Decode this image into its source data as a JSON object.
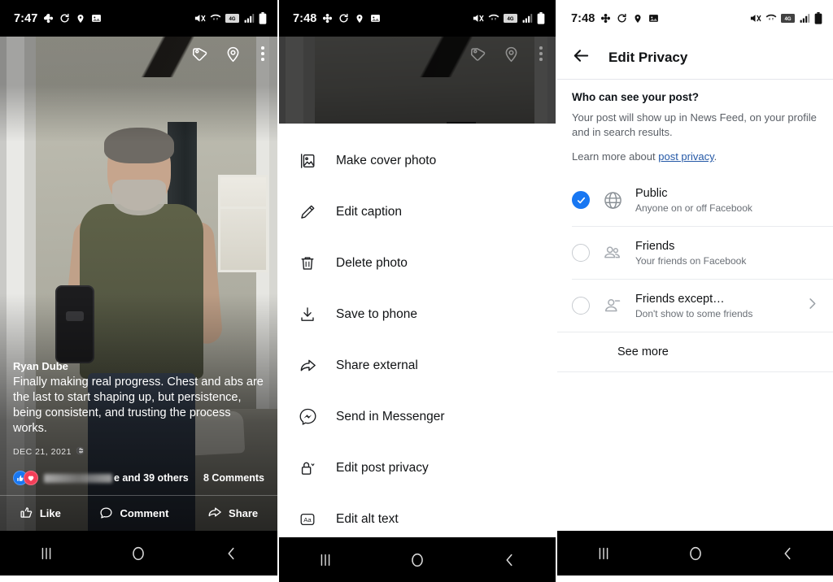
{
  "panels": {
    "photo_viewer": {
      "statusbar": {
        "time": "7:47",
        "left_icons": [
          "clover-icon",
          "sync-icon",
          "location-icon",
          "photo-icon"
        ],
        "right_icons": [
          "mute-icon",
          "wifi-transfer-icon",
          "lte-icon",
          "signal-icon",
          "battery-icon"
        ]
      },
      "topbar": {
        "tag_icon": "tag-icon",
        "location_icon": "location-pin-icon",
        "overflow_icon": "kebab-menu-icon"
      },
      "post": {
        "author": "Ryan Dube",
        "text": "Finally making real progress. Chest and abs are the last to start shaping up, but persistence, being consistent, and trusting the process works.",
        "date": "DEC 21, 2021",
        "audience_icon": "globe-icon",
        "reactions_icons": [
          "like-reaction-icon",
          "love-reaction-icon"
        ],
        "reactions_text": "e and 39 others",
        "comments_text": "8 Comments"
      },
      "actions": [
        {
          "label": "Like",
          "icon": "thumbs-up-icon"
        },
        {
          "label": "Comment",
          "icon": "comment-bubble-icon"
        },
        {
          "label": "Share",
          "icon": "share-arrow-icon"
        }
      ]
    },
    "photo_menu": {
      "statusbar": {
        "time": "7:48",
        "left_icons": [
          "clover-icon",
          "sync-icon",
          "location-icon",
          "photo-icon"
        ],
        "right_icons": [
          "mute-icon",
          "wifi-transfer-icon",
          "lte-icon",
          "signal-icon",
          "battery-icon"
        ]
      },
      "items": [
        {
          "label": "Make cover photo",
          "icon": "image-frame-icon"
        },
        {
          "label": "Edit caption",
          "icon": "pencil-icon"
        },
        {
          "label": "Delete photo",
          "icon": "trash-icon"
        },
        {
          "label": "Save to phone",
          "icon": "download-icon"
        },
        {
          "label": "Share external",
          "icon": "share-arrow-icon"
        },
        {
          "label": "Send in Messenger",
          "icon": "messenger-icon"
        },
        {
          "label": "Edit post privacy",
          "icon": "lock-icon"
        },
        {
          "label": "Edit alt text",
          "icon": "alt-text-icon"
        }
      ]
    },
    "edit_privacy": {
      "statusbar": {
        "time": "7:48",
        "left_icons": [
          "clover-icon",
          "sync-icon",
          "location-icon",
          "photo-icon"
        ],
        "right_icons": [
          "mute-icon",
          "wifi-transfer-icon",
          "lte-icon",
          "signal-icon",
          "battery-icon"
        ]
      },
      "header": {
        "back_icon": "back-arrow-icon",
        "title": "Edit Privacy"
      },
      "question": "Who can see your post?",
      "description": "Your post will show up in News Feed, on your profile and in search results.",
      "learn_prefix": "Learn more about ",
      "learn_link": "post privacy",
      "learn_suffix": ".",
      "options": [
        {
          "title": "Public",
          "subtitle": "Anyone on or off Facebook",
          "icon": "globe-icon",
          "selected": true,
          "has_chevron": false
        },
        {
          "title": "Friends",
          "subtitle": "Your friends on Facebook",
          "icon": "two-people-icon",
          "selected": false,
          "has_chevron": false
        },
        {
          "title": "Friends except…",
          "subtitle": "Don't show to some friends",
          "icon": "person-minus-icon",
          "selected": false,
          "has_chevron": true
        }
      ],
      "see_more": "See more"
    }
  },
  "navbar": {
    "recents_icon": "recents-icon",
    "home_icon": "home-circle-icon",
    "back_icon": "back-chevron-icon"
  },
  "colors": {
    "accent_blue": "#1877f2",
    "link_blue": "#2458a6",
    "like_blue": "#1877f2",
    "love_red": "#f33e58",
    "text_primary": "#111315",
    "text_secondary": "#6a6f76",
    "divider": "#e9ebee",
    "statusbar_dark": "#000000",
    "sheet_white": "#ffffff"
  }
}
